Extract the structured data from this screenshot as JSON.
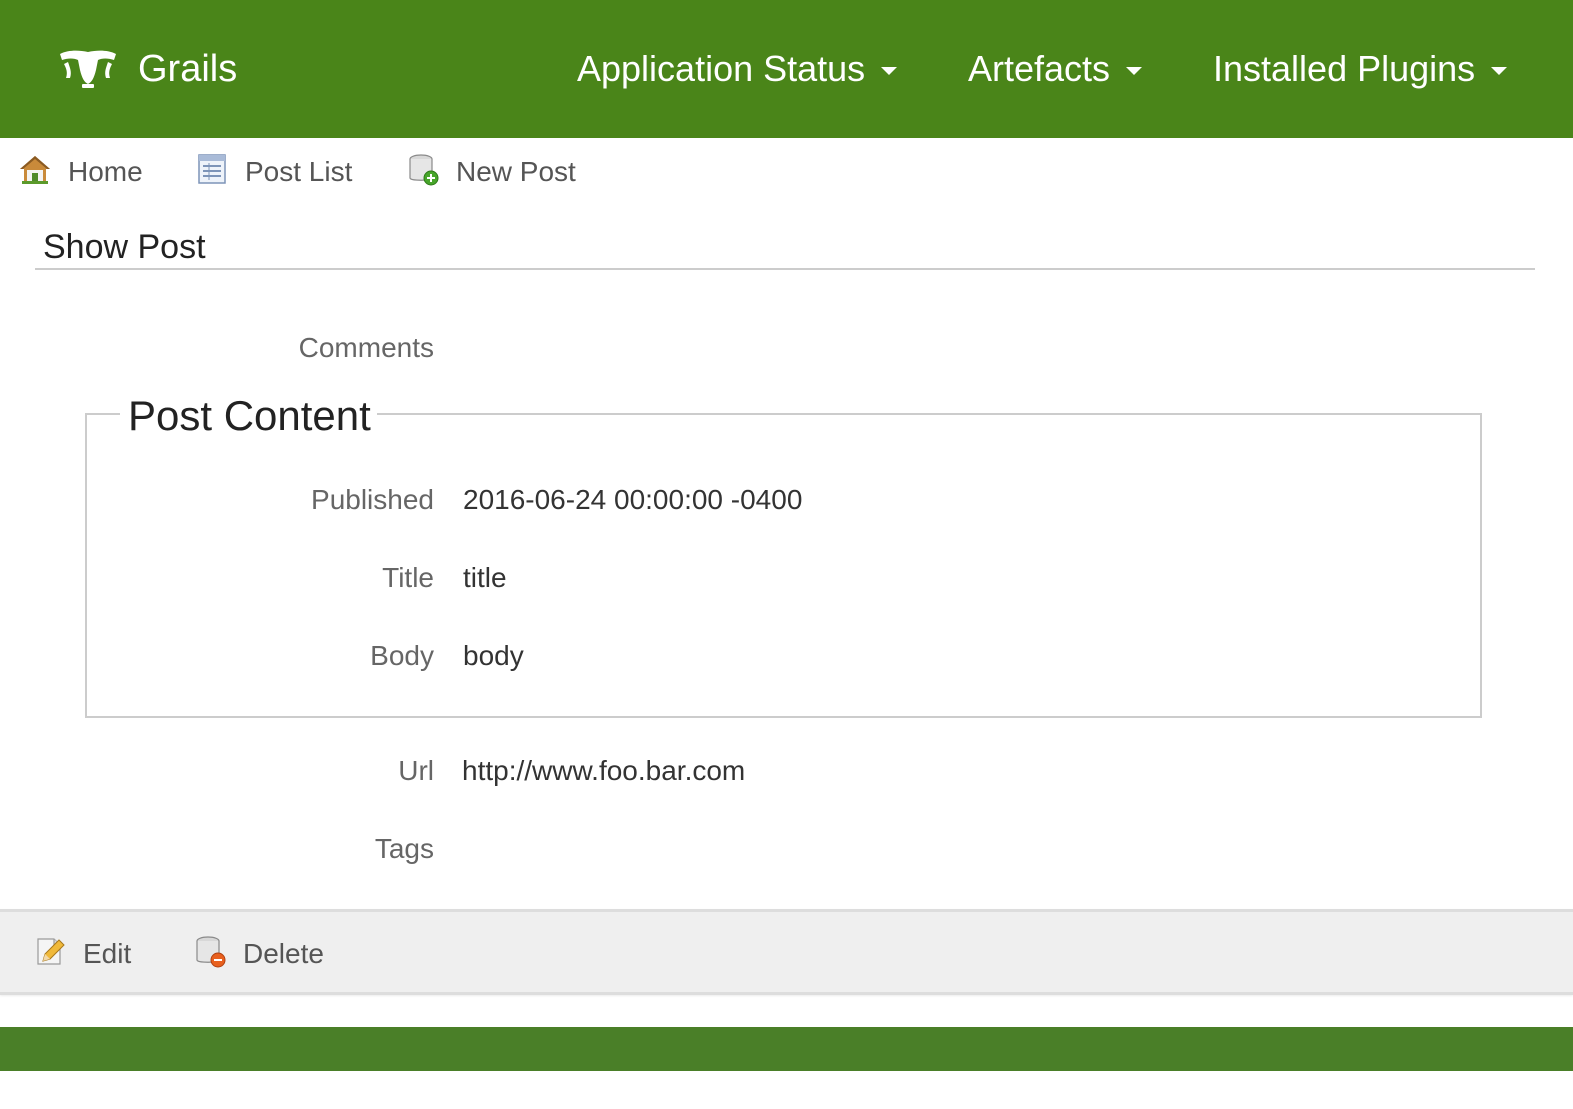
{
  "brand": {
    "name": "Grails"
  },
  "nav": {
    "application_status": "Application Status",
    "artefacts": "Artefacts",
    "installed_plugins": "Installed Plugins"
  },
  "subnav": {
    "home": "Home",
    "post_list": "Post List",
    "new_post": "New Post"
  },
  "page": {
    "title": "Show Post"
  },
  "fields": {
    "comments_label": "Comments",
    "fieldset_legend": "Post Content",
    "published_label": "Published",
    "published_value": "2016-06-24 00:00:00 -0400",
    "title_label": "Title",
    "title_value": "title",
    "body_label": "Body",
    "body_value": "body",
    "url_label": "Url",
    "url_value": "http://www.foo.bar.com",
    "tags_label": "Tags"
  },
  "buttons": {
    "edit": "Edit",
    "delete": "Delete"
  },
  "colors": {
    "navbar": "#4a8519",
    "footer": "#4a7f28",
    "button_bar": "#efefef"
  },
  "icons": {
    "brand": "grails-logo-icon",
    "home": "home-icon",
    "list": "list-icon",
    "create": "database-add-icon",
    "edit": "pencil-edit-icon",
    "delete": "database-delete-icon",
    "dropdown": "caret-down-icon"
  }
}
